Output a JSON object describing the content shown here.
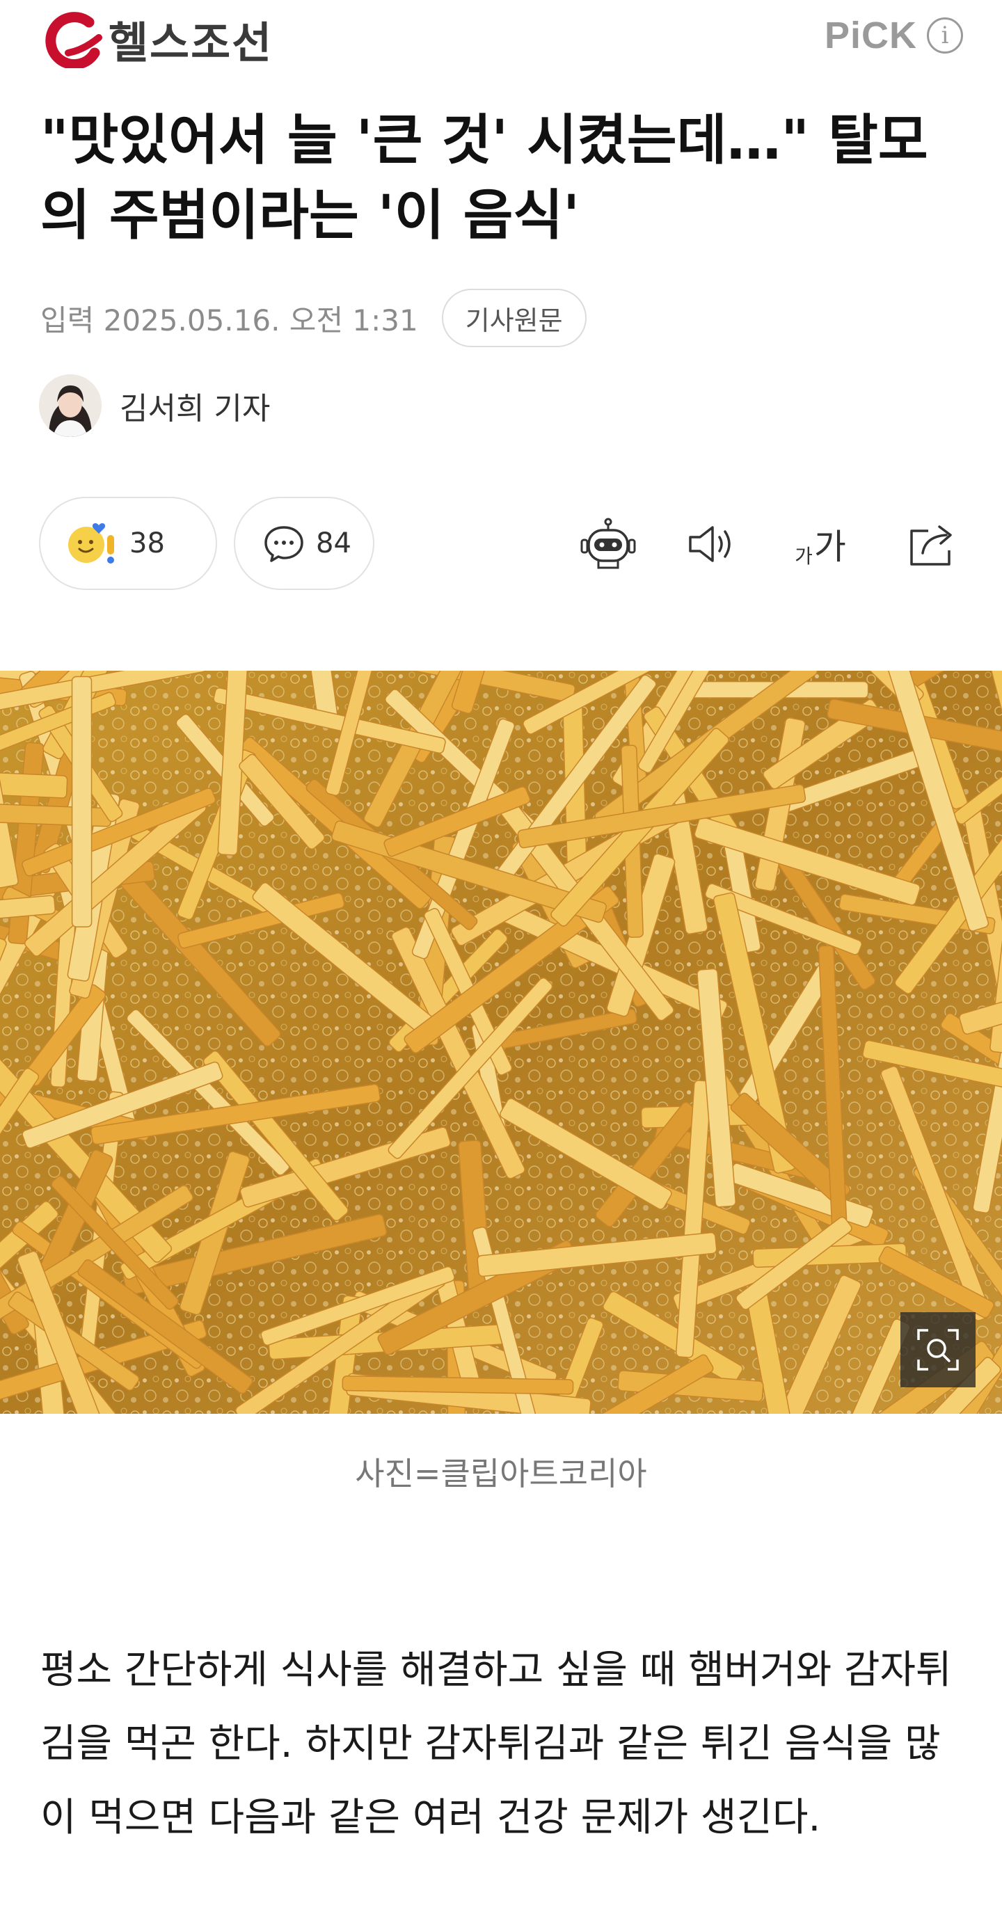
{
  "header": {
    "brand": "헬스조선",
    "pick_label": "PiCK",
    "info_glyph": "i",
    "brand_color": "#c8102e"
  },
  "article": {
    "headline": "\"맛있어서 늘 '큰 것' 시켰는데…\" 탈모의 주범이라는 '이 음식'",
    "date": "입력 2025.05.16. 오전 1:31",
    "original_button": "기사원문",
    "author": "김서희 기자",
    "reactions_count": "38",
    "comments_count": "84",
    "font_size_small": "가",
    "font_size_large": "가",
    "photo_caption": "사진=클립아트코리아",
    "body": "평소 간단하게 식사를 해결하고 싶을 때 햄버거와 감자튀김을 먹곤 한다. 하지만 감자튀김과 같은 튀긴 음식을 많이 먹으면 다음과 같은 여러 건강 문제가 생긴다."
  },
  "icons": [
    "reaction-emoji-icon",
    "comment-icon",
    "ai-summary-robot-icon",
    "speaker-icon",
    "font-size-icon",
    "share-icon",
    "zoom-icon"
  ]
}
